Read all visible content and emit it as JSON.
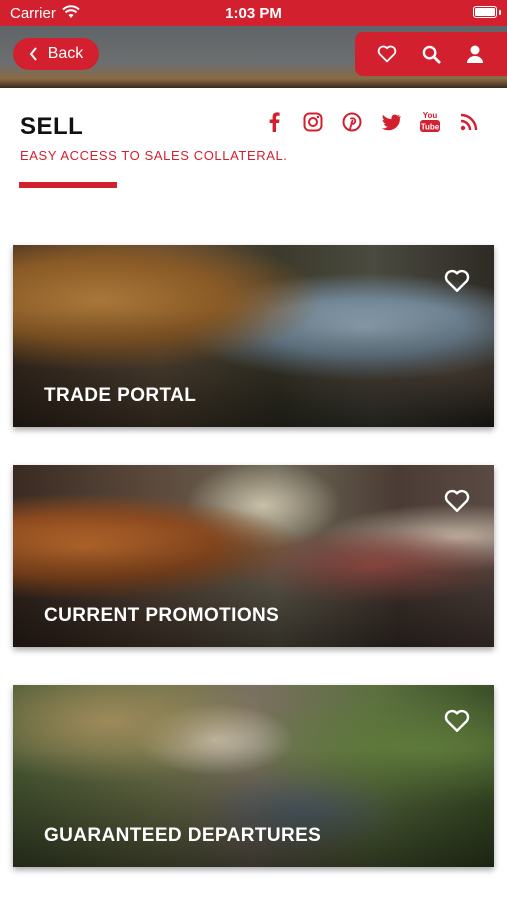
{
  "status_bar": {
    "carrier": "Carrier",
    "time": "1:03 PM"
  },
  "header": {
    "back_label": "Back",
    "toolbar_icons": [
      "heart-icon",
      "search-icon",
      "user-icon"
    ]
  },
  "section": {
    "title": "SELL",
    "subtitle": "EASY ACCESS TO SALES COLLATERAL.",
    "social_icons": [
      "facebook-icon",
      "instagram-icon",
      "pinterest-icon",
      "twitter-icon",
      "youtube-icon",
      "rss-icon"
    ],
    "youtube_text": "You Tube"
  },
  "cards": [
    {
      "label": "TRADE PORTAL",
      "icon": "heart-icon"
    },
    {
      "label": "CURRENT PROMOTIONS",
      "icon": "heart-icon"
    },
    {
      "label": "GUARANTEED DEPARTURES",
      "icon": "heart-icon"
    }
  ],
  "colors": {
    "accent": "#d3202f",
    "title": "#111111",
    "card_text": "#ffffff"
  }
}
